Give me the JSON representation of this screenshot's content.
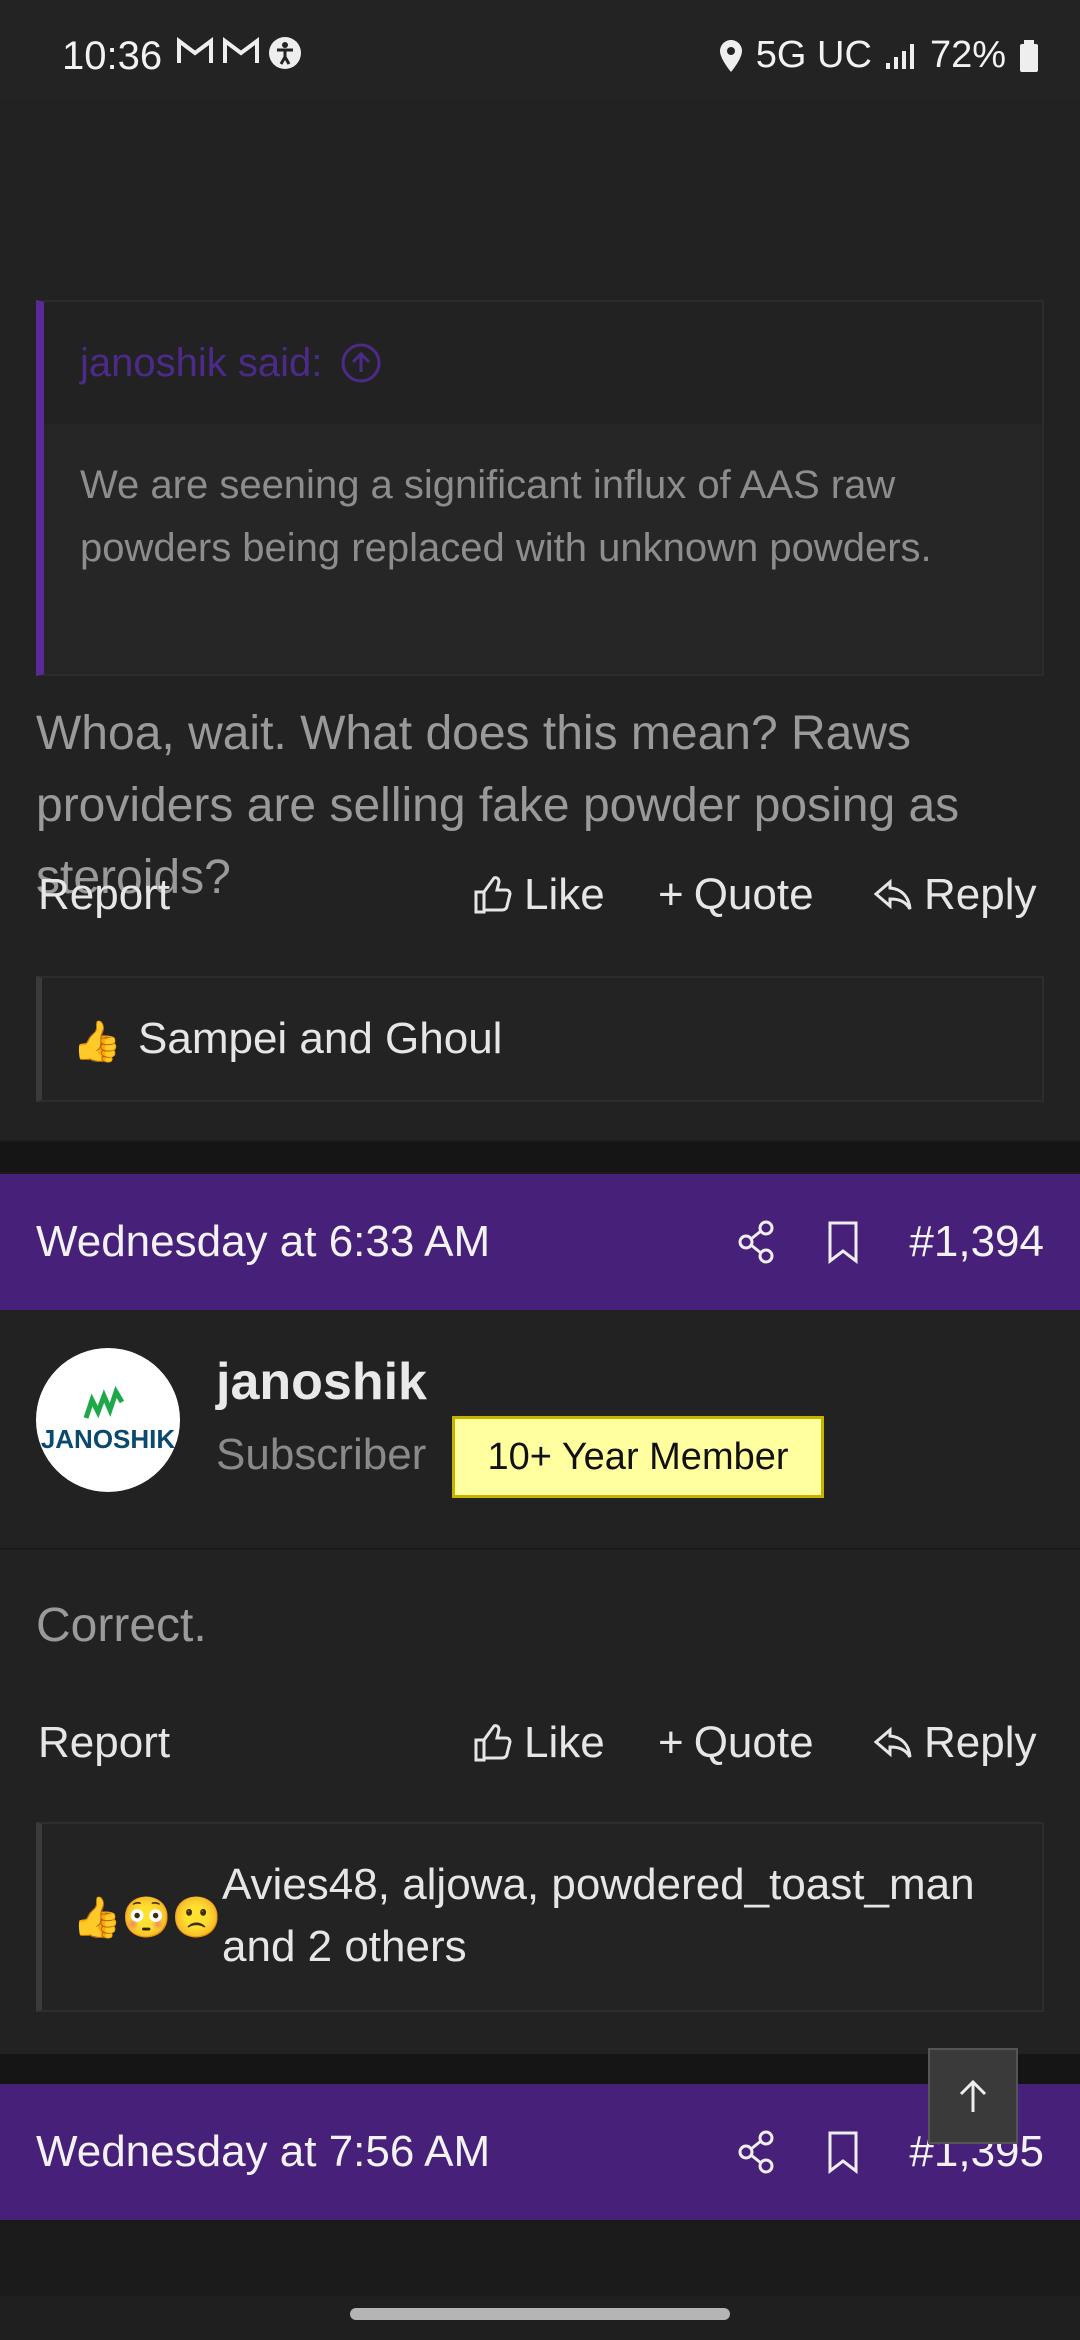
{
  "status_bar": {
    "time": "10:36",
    "network": "5G UC",
    "battery": "72%"
  },
  "post1": {
    "quote": {
      "author_said": "janoshik said:",
      "text": "We are seening a significant influx of AAS raw powders being replaced with unknown powders."
    },
    "body": "Whoa, wait. What does this mean? Raws providers are selling fake powder posing as steroids?",
    "actions": {
      "report": "Report",
      "like": "Like",
      "quote": "Quote",
      "reply": "Reply"
    },
    "reactions": {
      "emoji": "👍",
      "text": "Sampei and Ghoul"
    }
  },
  "post2": {
    "header": {
      "date": "Wednesday at 6:33 AM",
      "number": "#1,394"
    },
    "user": {
      "name": "janoshik",
      "role": "Subscriber",
      "badge": "10+ Year Member",
      "avatar_text": "JANOSHIK"
    },
    "body": "Correct.",
    "actions": {
      "report": "Report",
      "like": "Like",
      "quote": "Quote",
      "reply": "Reply"
    },
    "reactions": {
      "emoji": "👍😳🙁",
      "text": "Avies48, aljowa, powdered_toast_man and 2 others"
    }
  },
  "post3": {
    "header": {
      "date": "Wednesday at 7:56 AM",
      "number": "#1,395"
    }
  },
  "colors": {
    "accent_purple": "#462079",
    "quote_border": "#5a2a9b",
    "badge_bg": "#ffffa0"
  }
}
